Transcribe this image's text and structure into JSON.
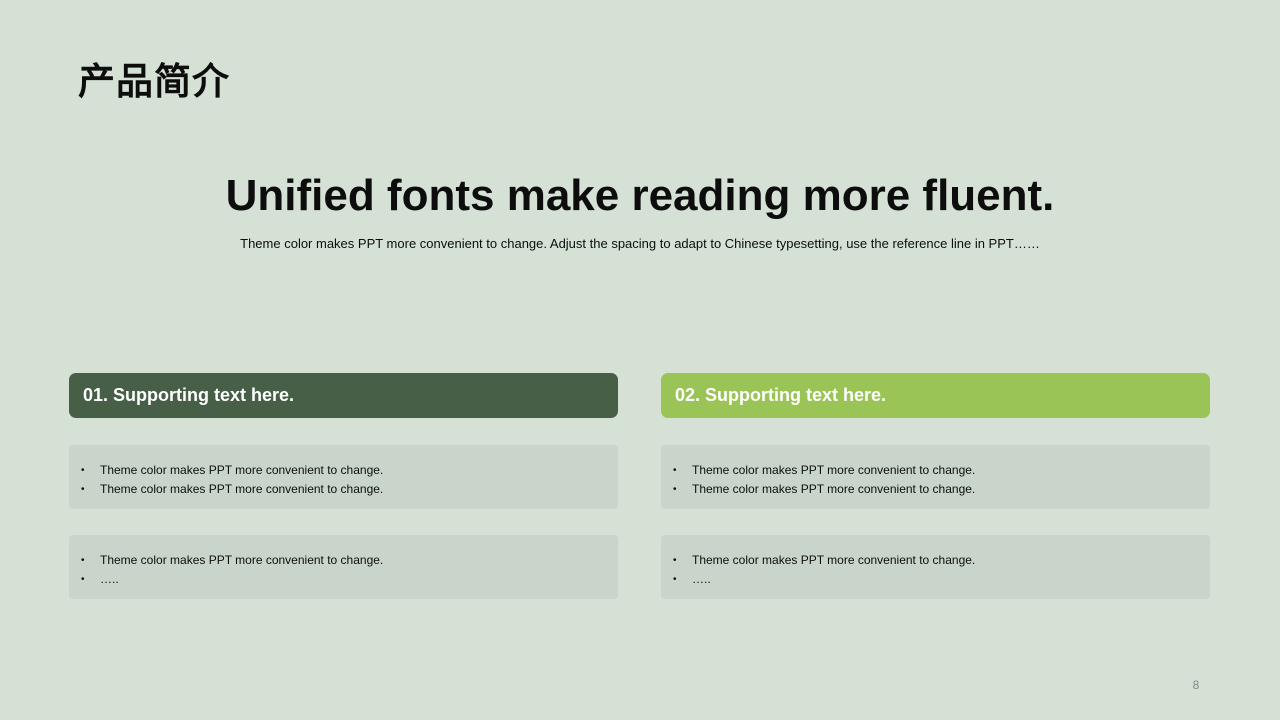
{
  "slide": {
    "title": "产品简介",
    "headline": "Unified fonts make reading more fluent.",
    "subline": "Theme color makes PPT more convenient to change. Adjust the spacing to adapt to Chinese typesetting, use the reference line in PPT……",
    "page_number": "8"
  },
  "colors": {
    "background": "#d6e1d6",
    "header_1": "#465f46",
    "header_2": "#9bc456",
    "card": "#c9d5cb"
  },
  "columns": [
    {
      "header": "01. Supporting text here.",
      "cards": [
        {
          "bullets": [
            "Theme color makes PPT more convenient to change.",
            "Theme color makes PPT more convenient to change."
          ]
        },
        {
          "bullets": [
            "Theme color makes PPT more convenient to change.",
            "….."
          ]
        }
      ]
    },
    {
      "header": "02. Supporting text here.",
      "cards": [
        {
          "bullets": [
            "Theme color makes PPT more convenient to change.",
            "Theme color makes PPT more convenient to change."
          ]
        },
        {
          "bullets": [
            "Theme color makes PPT more convenient to change.",
            "….."
          ]
        }
      ]
    }
  ]
}
